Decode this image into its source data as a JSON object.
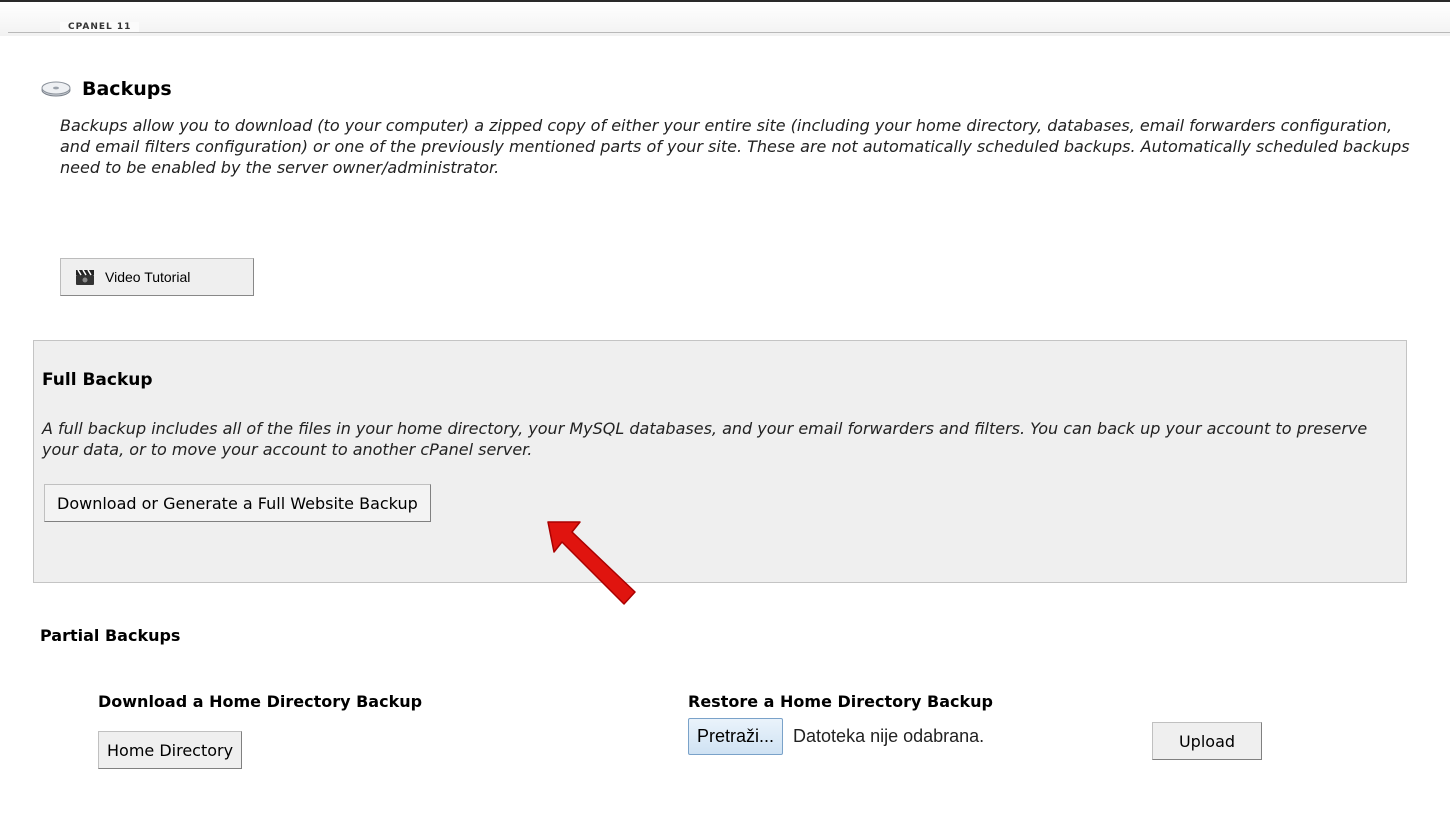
{
  "header": {
    "brand": "CPANEL 11"
  },
  "page": {
    "title": "Backups",
    "intro": "Backups allow you to download (to your computer) a zipped copy of either your entire site (including your home directory, databases, email forwarders configuration, and email filters configuration) or one of the previously mentioned parts of your site. These are not automatically scheduled backups. Automatically scheduled backups need to be enabled by the server owner/administrator.",
    "video_button": "Video Tutorial"
  },
  "full_backup": {
    "title": "Full Backup",
    "description": "A full backup includes all of the files in your home directory, your MySQL databases, and your email forwarders and filters. You can back up your account to preserve your data, or to move your account to another cPanel server.",
    "button": "Download or Generate a Full Website Backup"
  },
  "partial_backups": {
    "title": "Partial Backups",
    "download": {
      "title": "Download a Home Directory Backup",
      "button": "Home Directory"
    },
    "restore": {
      "title": "Restore a Home Directory Backup",
      "browse_button": "Pretraži...",
      "file_status": "Datoteka nije odabrana.",
      "upload_button": "Upload"
    }
  },
  "colors": {
    "arrow": "#e0140f",
    "panel_bg": "#efefef"
  }
}
